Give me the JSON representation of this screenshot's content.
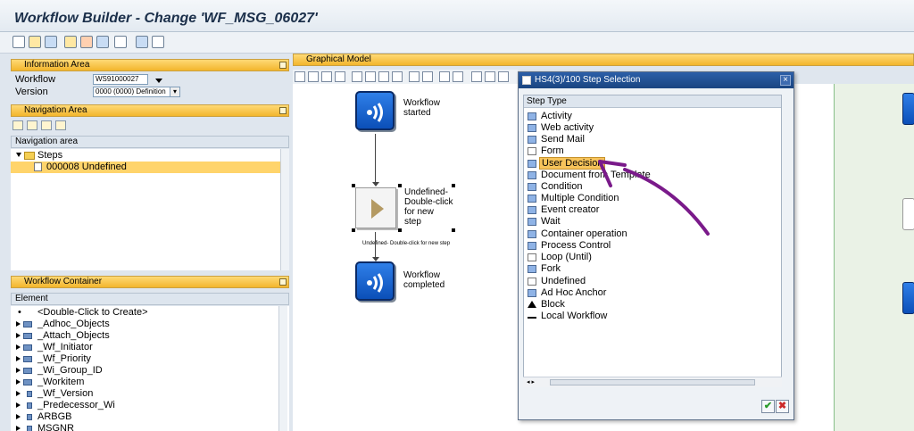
{
  "window": {
    "title": "Workflow Builder - Change 'WF_MSG_06027'"
  },
  "info_area": {
    "header": "Information Area",
    "workflow_label": "Workflow",
    "workflow_value": "WS91000027",
    "version_label": "Version",
    "version_value": "0000 (0000) Definition"
  },
  "navigation_area": {
    "header": "Navigation Area",
    "subheader": "Navigation area",
    "items": [
      {
        "label": "Steps"
      },
      {
        "label": "000008 Undefined"
      }
    ]
  },
  "workflow_container": {
    "header": "Workflow Container",
    "column": "Element",
    "items": [
      {
        "label": "<Double-Click to Create>"
      },
      {
        "label": "_Adhoc_Objects"
      },
      {
        "label": "_Attach_Objects"
      },
      {
        "label": "_Wf_Initiator"
      },
      {
        "label": "_Wf_Priority"
      },
      {
        "label": "_Wi_Group_ID"
      },
      {
        "label": "_Workitem"
      },
      {
        "label": "_Wf_Version"
      },
      {
        "label": "_Predecessor_Wi"
      },
      {
        "label": "ARBGB"
      },
      {
        "label": "MSGNR"
      }
    ]
  },
  "graphical_model": {
    "header": "Graphical Model",
    "nodes": {
      "started": "Workflow started",
      "undefined_line1": "Undefined-",
      "undefined_line2": "Double-click",
      "undefined_line3": "for new",
      "undefined_line4": "step",
      "edge_label": "Undefined- Double-click for new step",
      "completed": "Workflow completed"
    }
  },
  "step_dialog": {
    "title": "HS4(3)/100 Step Selection",
    "column": "Step Type",
    "selected": "User Decision",
    "items": [
      {
        "label": "Activity"
      },
      {
        "label": "Web activity"
      },
      {
        "label": "Send Mail"
      },
      {
        "label": "Form"
      },
      {
        "label": "User Decision"
      },
      {
        "label": "Document from Template"
      },
      {
        "label": "Condition"
      },
      {
        "label": "Multiple Condition"
      },
      {
        "label": "Event creator"
      },
      {
        "label": "Wait"
      },
      {
        "label": "Container operation"
      },
      {
        "label": "Process Control"
      },
      {
        "label": "Loop (Until)"
      },
      {
        "label": "Fork"
      },
      {
        "label": "Undefined"
      },
      {
        "label": "Ad Hoc Anchor"
      },
      {
        "label": "Block"
      },
      {
        "label": "Local Workflow"
      }
    ],
    "ok_symbol": "✔",
    "cancel_symbol": "✖"
  },
  "colors": {
    "accent": "#f3b52c",
    "selection": "#ffd46b",
    "annotation": "#7a1a8a"
  }
}
